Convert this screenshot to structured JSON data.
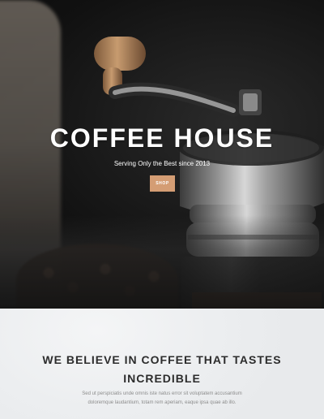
{
  "hero": {
    "title": "COFFEE HOUSE",
    "subtitle": "Serving Only the Best since 2013",
    "cta_label": "SHOP",
    "cta_color": "#d49d74"
  },
  "about": {
    "heading_line1": "WE BELIEVE IN COFFEE THAT TASTES",
    "heading_line2": "INCREDIBLE",
    "body_line1": "Sed ut perspiciatis unde omnis iste natus error sit voluptatem accusantium",
    "body_line2": "doloremque laudantium, totam rem aperiam, eaque ipsa quae ab illo."
  }
}
